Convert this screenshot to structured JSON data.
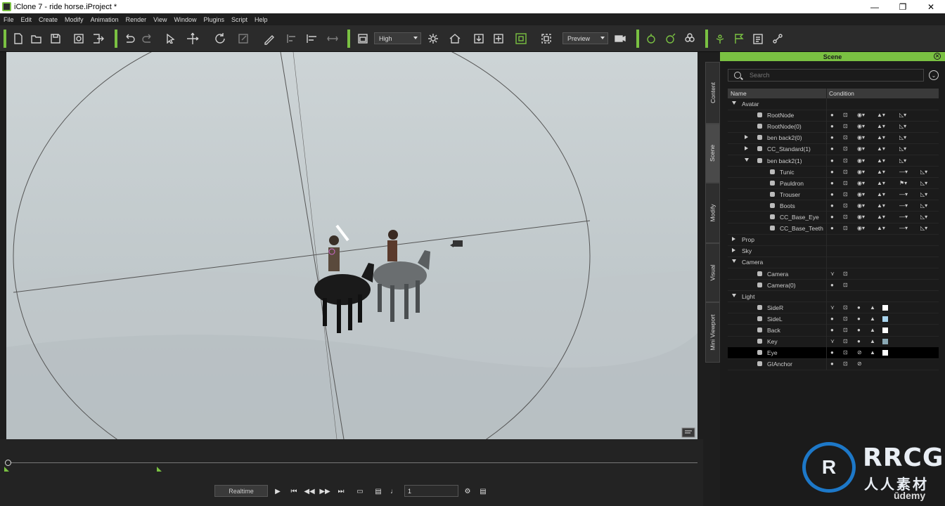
{
  "window": {
    "title": "iClone 7 - ride horse.iProject *",
    "controls": [
      "—",
      "❐",
      "✕"
    ]
  },
  "menu": [
    "File",
    "Edit",
    "Create",
    "Modify",
    "Animation",
    "Render",
    "View",
    "Window",
    "Plugins",
    "Script",
    "Help"
  ],
  "toolbar": {
    "quality": "High",
    "render_mode": "Preview",
    "icons": [
      "new-file-icon",
      "open-folder-icon",
      "save-icon",
      "project-settings-icon",
      "export-icon",
      "undo-icon",
      "redo-icon",
      "select-arrow-icon",
      "move-icon",
      "rotate-icon",
      "scale-icon",
      "pick-icon",
      "align-icon",
      "align-bottom-icon",
      "snap-icon",
      "view-mode-icon",
      "sun-icon",
      "home-icon",
      "frame-icon",
      "fit-icon",
      "grid-icon",
      "camera-switch-icon",
      "camera-icon",
      "prop-tool-icon",
      "prop-tool-2-icon",
      "group-icon",
      "puppet-icon",
      "flag-icon",
      "clipboard-icon",
      "path-icon"
    ]
  },
  "side_tabs": [
    "Content",
    "Scene",
    "Modify",
    "Visual",
    "Mini Viewport"
  ],
  "scene_panel": {
    "title": "Scene",
    "search_placeholder": "Search",
    "columns": {
      "name": "Name",
      "condition": "Condition"
    },
    "rows": [
      {
        "label": "Avatar",
        "level": 0,
        "expander": "open",
        "icon": "",
        "cond": ""
      },
      {
        "label": "RootNode",
        "level": 2,
        "expander": "",
        "icon": "bone-icon",
        "cond": "avatar"
      },
      {
        "label": "RootNode(0)",
        "level": 2,
        "expander": "",
        "icon": "bone-icon",
        "cond": "avatar"
      },
      {
        "label": "ben back2(0)",
        "level": 2,
        "expander": "closed",
        "icon": "person-icon",
        "cond": "avatar"
      },
      {
        "label": "CC_Standard(1)",
        "level": 2,
        "expander": "closed",
        "icon": "person-icon",
        "cond": "avatar"
      },
      {
        "label": "ben back2(1)",
        "level": 2,
        "expander": "open",
        "icon": "person-icon",
        "cond": "avatar"
      },
      {
        "label": "Tunic",
        "level": 3,
        "expander": "",
        "icon": "shirt-icon",
        "cond": "cloth"
      },
      {
        "label": "Pauldron",
        "level": 3,
        "expander": "",
        "icon": "shirt-icon",
        "cond": "cloth-flag"
      },
      {
        "label": "Trouser",
        "level": 3,
        "expander": "",
        "icon": "trouser-icon",
        "cond": "cloth"
      },
      {
        "label": "Boots",
        "level": 3,
        "expander": "",
        "icon": "boot-icon",
        "cond": "cloth"
      },
      {
        "label": "CC_Base_Eye",
        "level": 3,
        "expander": "",
        "icon": "eye-icon",
        "cond": "cloth"
      },
      {
        "label": "CC_Base_Teeth",
        "level": 3,
        "expander": "",
        "icon": "teeth-icon",
        "cond": "cloth"
      },
      {
        "label": "Prop",
        "level": 0,
        "expander": "closed",
        "icon": "",
        "cond": ""
      },
      {
        "label": "Sky",
        "level": 0,
        "expander": "closed",
        "icon": "",
        "cond": ""
      },
      {
        "label": "Camera",
        "level": 0,
        "expander": "open",
        "icon": "",
        "cond": ""
      },
      {
        "label": "Camera",
        "level": 2,
        "expander": "",
        "icon": "camera-icon",
        "cond": "camera-hidden"
      },
      {
        "label": "Camera(0)",
        "level": 2,
        "expander": "",
        "icon": "camera-icon",
        "cond": "camera"
      },
      {
        "label": "Light",
        "level": 0,
        "expander": "open",
        "icon": "",
        "cond": ""
      },
      {
        "label": "SideR",
        "level": 2,
        "expander": "",
        "icon": "spotlight-icon",
        "cond": "light-hidden",
        "color": "#ffffff"
      },
      {
        "label": "SideL",
        "level": 2,
        "expander": "",
        "icon": "spotlight-icon",
        "cond": "light",
        "color": "#a9d4ee"
      },
      {
        "label": "Back",
        "level": 2,
        "expander": "",
        "icon": "spotlight-icon",
        "cond": "light",
        "color": "#ffffff"
      },
      {
        "label": "Key",
        "level": 2,
        "expander": "",
        "icon": "spotlight-icon",
        "cond": "light-hidden",
        "color": "#8aa8b4"
      },
      {
        "label": "Eye",
        "level": 2,
        "expander": "",
        "icon": "spotlight-icon",
        "cond": "light-off",
        "color": "#ffffff",
        "selected": true
      },
      {
        "label": "GIAnchor",
        "level": 2,
        "expander": "",
        "icon": "anchor-icon",
        "cond": "anchor"
      }
    ]
  },
  "playback": {
    "mode": "Realtime",
    "frame": "1"
  },
  "colors": {
    "accent": "#7ac142",
    "viewport_bg": "#c6cdd0",
    "panel_bg": "#1b1b1b"
  },
  "watermark": {
    "logo_text": "R",
    "brand": "RRCG",
    "cn": "人人素材"
  },
  "udemy": "ūdemy"
}
